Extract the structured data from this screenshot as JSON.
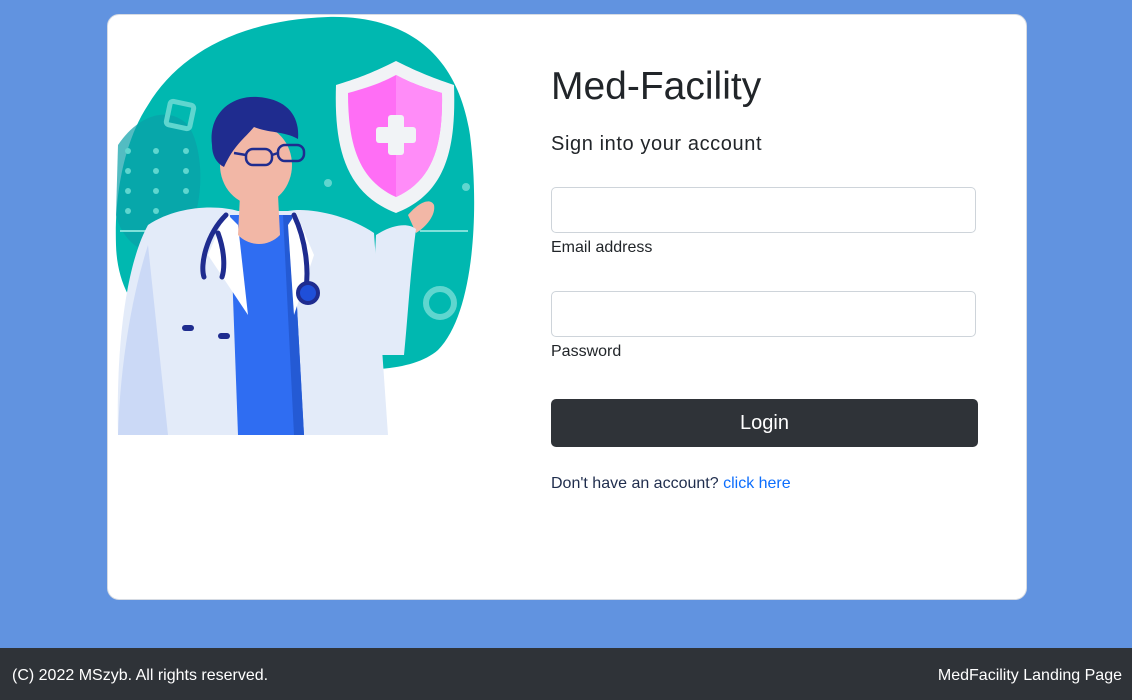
{
  "login": {
    "title": "Med-Facility",
    "subtitle": "Sign into your account",
    "email_label": "Email address",
    "email_value": "",
    "password_label": "Password",
    "password_value": "",
    "login_button": "Login",
    "signup_prompt": "Don't have an account?",
    "signup_link": "click here"
  },
  "footer": {
    "copyright": "(C) 2022 MSzyb. All rights reserved.",
    "landing_link": "MedFacility Landing Page"
  },
  "colors": {
    "page_background": "#6193e0",
    "card_background": "#ffffff",
    "button_background": "#2f3338",
    "link": "#0d6efd",
    "illustration_blob": "#00b8b0",
    "shield": "#ff6ef5"
  },
  "icons": [
    "doctor-illustration",
    "shield-plus-icon",
    "stethoscope-icon"
  ]
}
